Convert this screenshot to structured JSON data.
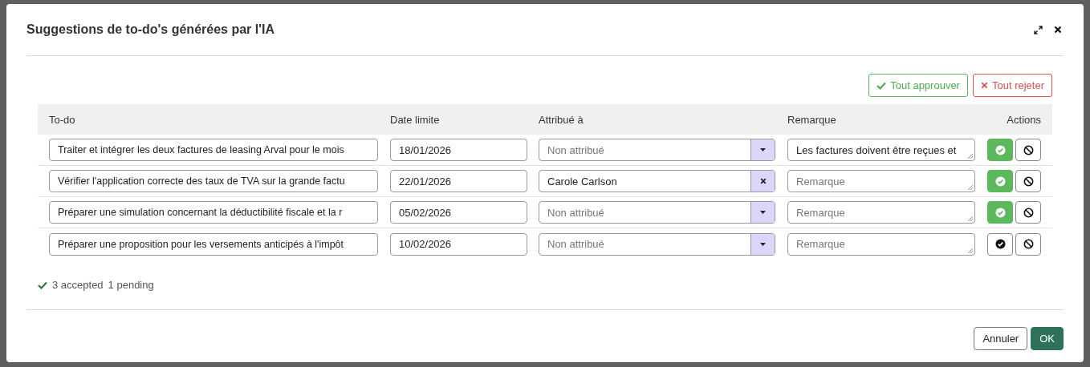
{
  "dialog": {
    "title": "Suggestions de to-do's générées par l'IA"
  },
  "bulk_actions": [
    {
      "kind": "approve",
      "label": "Tout approuver"
    },
    {
      "kind": "reject",
      "label": "Tout rejeter"
    }
  ],
  "table": {
    "columns": [
      "To-do",
      "Date limite",
      "Attribué à",
      "Remarque",
      "Actions"
    ],
    "rows": [
      {
        "todo": "Traiter et intégrer les deux factures de leasing Arval pour le mois",
        "due": "18/01/2026",
        "assignee_placeholder": "Non attribué",
        "remark": "Les factures doivent être reçues et",
        "approved": true
      },
      {
        "todo": "Vérifier l'application correcte des taux de TVA sur la grande factu",
        "due": "22/01/2026",
        "assignee": "Carole Carlson",
        "remark_placeholder": "Remarque",
        "approved": true
      },
      {
        "todo": "Préparer une simulation concernant la déductibilité fiscale et la r",
        "due": "05/02/2026",
        "assignee_placeholder": "Non attribué",
        "remark_placeholder": "Remarque",
        "approved": true
      },
      {
        "todo": "Préparer une proposition pour les versements anticipés à l'impôt",
        "due": "10/02/2026",
        "assignee_placeholder": "Non attribué",
        "remark_placeholder": "Remarque",
        "approved": false
      }
    ]
  },
  "summary": {
    "accepted": "3 accepted",
    "pending": "1 pending"
  },
  "footer_buttons": [
    {
      "kind": "cancel",
      "label": "Annuler"
    },
    {
      "kind": "ok",
      "label": "OK"
    }
  ]
}
